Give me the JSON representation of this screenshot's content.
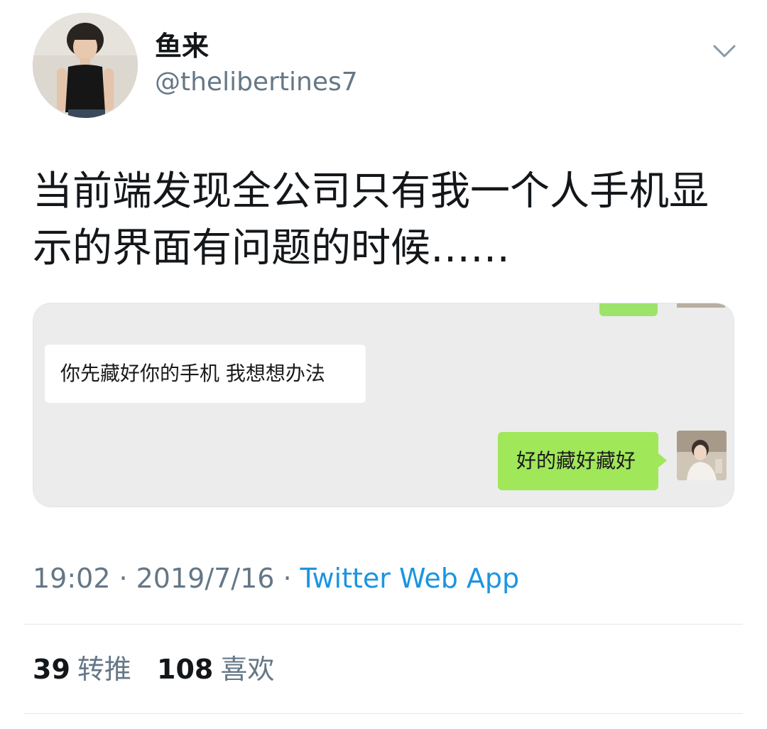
{
  "tweet": {
    "author": {
      "display_name": "鱼来",
      "handle": "@thelibertines7",
      "avatar_icon": "profile-photo"
    },
    "more_icon": "chevron-down-icon",
    "text": "当前端发现全公司只有我一个人手机显示的界面有问题的时候……",
    "media": {
      "chat": {
        "incoming_message": "你先藏好你的手机  我想想办法",
        "outgoing_message": "好的藏好藏好",
        "incoming_bubble_color": "#ffffff",
        "outgoing_bubble_color": "#a0e75a",
        "background_color": "#ececec"
      }
    },
    "meta": {
      "time": "19:02",
      "separator": "·",
      "date": "2019/7/16",
      "source": "Twitter Web App"
    },
    "stats": {
      "retweets_count": "39",
      "retweets_label": "转推",
      "likes_count": "108",
      "likes_label": "喜欢"
    }
  },
  "colors": {
    "primary_text": "#14171a",
    "secondary_text": "#657786",
    "link": "#1b95e0",
    "divider": "#e1e8ed"
  }
}
